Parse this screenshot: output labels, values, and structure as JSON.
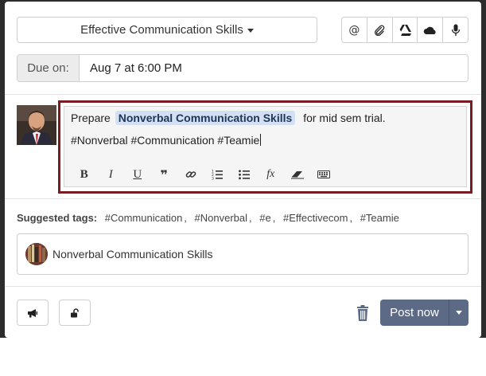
{
  "header": {
    "group_label": "Effective Communication Skills",
    "tools": [
      {
        "name": "mention-icon",
        "glyph": "@"
      },
      {
        "name": "paperclip-icon"
      },
      {
        "name": "google-drive-icon"
      },
      {
        "name": "onedrive-icon"
      },
      {
        "name": "microphone-icon"
      }
    ]
  },
  "due": {
    "label": "Due on:",
    "value": "Aug 7 at 6:00 PM"
  },
  "editor": {
    "prefix": "Prepare",
    "mention": "Nonverbal Communication Skills",
    "suffix": "for mid sem trial.",
    "hashtags": "#Nonverbal #Communication #Teamie",
    "toolbar": [
      {
        "name": "bold-icon",
        "glyph": "B"
      },
      {
        "name": "italic-icon",
        "glyph": "I"
      },
      {
        "name": "underline-icon",
        "glyph": "U"
      },
      {
        "name": "quote-icon",
        "glyph": "❞"
      },
      {
        "name": "link-icon"
      },
      {
        "name": "numbered-list-icon"
      },
      {
        "name": "bulleted-list-icon"
      },
      {
        "name": "formula-icon",
        "glyph": "fx"
      },
      {
        "name": "eraser-icon"
      },
      {
        "name": "keyboard-icon"
      }
    ],
    "outline_color": "#7a1c22"
  },
  "suggested": {
    "label": "Suggested tags:",
    "tags": [
      "#Communication",
      "#Nonverbal",
      "#e",
      "#Effectivecom",
      "#Teamie"
    ]
  },
  "course": {
    "name": "Nonverbal Communication Skills"
  },
  "footer": {
    "post_label": "Post now",
    "post_color": "#5c6a85"
  }
}
